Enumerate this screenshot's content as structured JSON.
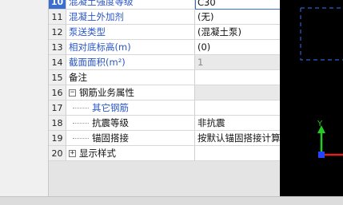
{
  "property_table": {
    "rows": [
      {
        "num": "10",
        "name": "混凝土强度等级",
        "value": "C30",
        "checkbox": true,
        "name_blue": true,
        "selected": true
      },
      {
        "num": "11",
        "name": "混凝土外加剂",
        "value": "(无)",
        "checkbox": false,
        "name_blue": true
      },
      {
        "num": "12",
        "name": "泵送类型",
        "value": "(混凝土泵)",
        "checkbox": false,
        "name_blue": true
      },
      {
        "num": "13",
        "name": "相对底标高(m)",
        "value": "(0)",
        "checkbox": true,
        "name_blue": true
      },
      {
        "num": "14",
        "name": "截面面积(m²)",
        "value": "1",
        "checkbox": true,
        "name_blue": true,
        "value_gray": true
      },
      {
        "num": "15",
        "name": "备注",
        "value": "",
        "checkbox": true,
        "name_blue": false
      },
      {
        "num": "16",
        "name": "钢筋业务属性",
        "value": "",
        "checkbox": false,
        "name_blue": false,
        "toggle": "−",
        "value_gray": true
      },
      {
        "num": "17",
        "name": "其它钢筋",
        "value": "",
        "checkbox": false,
        "name_blue": true,
        "child": true
      },
      {
        "num": "18",
        "name": "抗震等级",
        "value": "非抗震",
        "checkbox": false,
        "name_blue": false,
        "child": true
      },
      {
        "num": "19",
        "name": "锚固搭接",
        "value": "按默认锚固搭接计算",
        "checkbox": false,
        "name_blue": false,
        "child": true
      },
      {
        "num": "20",
        "name": "显示样式",
        "value": "",
        "checkbox": false,
        "name_blue": false,
        "toggle": "+"
      }
    ]
  },
  "viewport": {
    "axis_y_label": "Y",
    "axis_y_color": "#22cc22",
    "axis_x_color": "#dd2222",
    "origin_color": "#2244ff",
    "dashed_color": "#2a5fd0"
  }
}
